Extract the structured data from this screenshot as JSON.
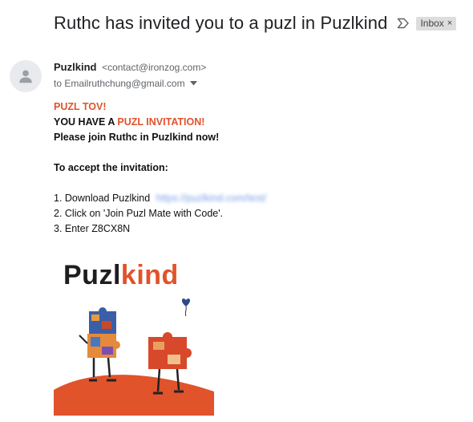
{
  "email": {
    "subject": "Ruthc has invited you to a puzl in Puzlkind",
    "label": "Inbox",
    "label_close": "×",
    "sender_name": "Puzlkind",
    "sender_email": "<contact@ironzog.com>",
    "recipient_line": "to Emailruthchung@gmail.com"
  },
  "body": {
    "line1": "PUZL TOV!",
    "line2_prefix": "YOU HAVE A ",
    "line2_highlight": "PUZL INVITATION!",
    "line3": "Please join Ruthc in Puzlkind now!",
    "accept_heading": "To accept the invitation:",
    "step1_text": "1. Download Puzlkind",
    "step1_link": "https://puzlkind.com/test/",
    "step2": "2. Click on 'Join Puzl Mate with Code'.",
    "step3": "3. Enter Z8CX8N"
  },
  "logo": {
    "part1": "Puzl",
    "part2": "kind"
  },
  "colors": {
    "accent": "#e0532b",
    "chip_bg": "#dddddd",
    "link": "#7aa0e8"
  },
  "icons": {
    "important": "important-marker-icon",
    "avatar": "person-icon",
    "caret": "dropdown-caret-icon"
  }
}
